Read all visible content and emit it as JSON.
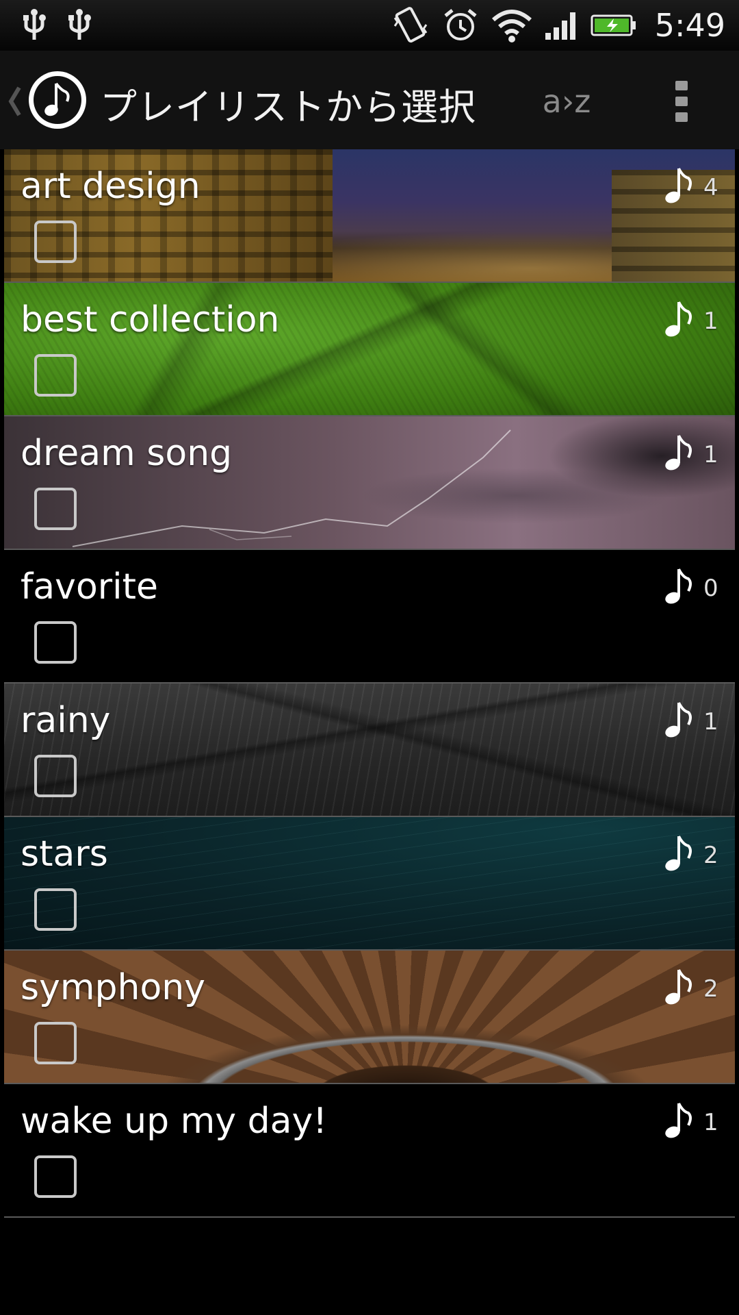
{
  "status_bar": {
    "time": "5:49",
    "left_icons": [
      "usb-icon",
      "usb-icon"
    ],
    "right_icons": [
      "vibrate-icon",
      "alarm-icon",
      "wifi-icon",
      "signal-icon",
      "battery-charging-icon"
    ]
  },
  "action_bar": {
    "title": "プレイリストから選択",
    "sort_label": "a›z",
    "app_icon": "music-note-icon",
    "menu_icon": "overflow-menu-icon"
  },
  "playlists": [
    {
      "name": "art design",
      "count": "4",
      "background": "city-night"
    },
    {
      "name": "best collection",
      "count": "1",
      "background": "green-leaf"
    },
    {
      "name": "dream song",
      "count": "1",
      "background": "lightning-storm"
    },
    {
      "name": "favorite",
      "count": "0",
      "background": "none"
    },
    {
      "name": "rainy",
      "count": "1",
      "background": "rain-street"
    },
    {
      "name": "stars",
      "count": "2",
      "background": "star-trails"
    },
    {
      "name": "symphony",
      "count": "2",
      "background": "spiral-staircase"
    },
    {
      "name": "wake up my day!",
      "count": "1",
      "background": "none"
    }
  ],
  "colors": {
    "background": "#000000",
    "action_bar": "#121212",
    "text": "#ffffff",
    "divider": "#5a5a5a"
  }
}
